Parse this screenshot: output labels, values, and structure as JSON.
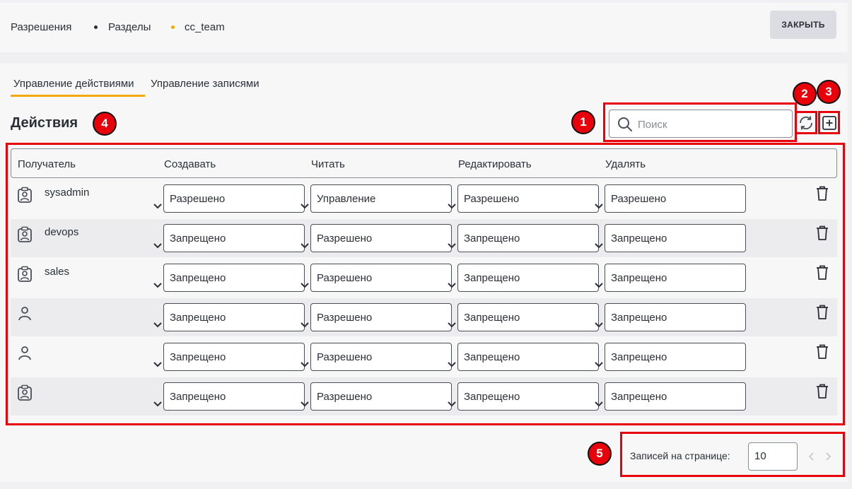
{
  "breadcrumb": {
    "items": [
      "Разрешения",
      "Разделы",
      "cc_team"
    ],
    "dot_colors": [
      "#2b2f36",
      "#f2a900"
    ]
  },
  "header": {
    "close_label": "ЗАКРЫТЬ"
  },
  "tabs": [
    {
      "label": "Управление действиями",
      "active": true
    },
    {
      "label": "Управление записями",
      "active": false
    }
  ],
  "section": {
    "title": "Действия"
  },
  "search": {
    "placeholder": "Поиск",
    "value": ""
  },
  "table": {
    "columns": [
      "Получатель",
      "Создавать",
      "Читать",
      "Редактировать",
      "Удалять"
    ],
    "rows": [
      {
        "icon": "group-icon",
        "name": "sysadmin",
        "create": "Разрешено",
        "read": "Управление",
        "edit": "Разрешено",
        "delete": "Разрешено"
      },
      {
        "icon": "group-icon",
        "name": "devops",
        "create": "Запрещено",
        "read": "Разрешено",
        "edit": "Запрещено",
        "delete": "Запрещено"
      },
      {
        "icon": "group-icon",
        "name": "sales",
        "create": "Запрещено",
        "read": "Разрешено",
        "edit": "Запрещено",
        "delete": "Запрещено"
      },
      {
        "icon": "user-icon",
        "name": "",
        "create": "Запрещено",
        "read": "Разрешено",
        "edit": "Запрещено",
        "delete": "Запрещено"
      },
      {
        "icon": "user-icon",
        "name": "",
        "create": "Запрещено",
        "read": "Разрешено",
        "edit": "Запрещено",
        "delete": "Запрещено"
      },
      {
        "icon": "group-icon",
        "name": "",
        "create": "Запрещено",
        "read": "Разрешено",
        "edit": "Запрещено",
        "delete": "Запрещено"
      }
    ]
  },
  "pagination": {
    "label": "Записей на странице:",
    "page_size": "10"
  },
  "markers": [
    "1",
    "2",
    "3",
    "4",
    "5"
  ],
  "colors": {
    "accent": "#f2a900",
    "annotation": "#e8000b"
  }
}
